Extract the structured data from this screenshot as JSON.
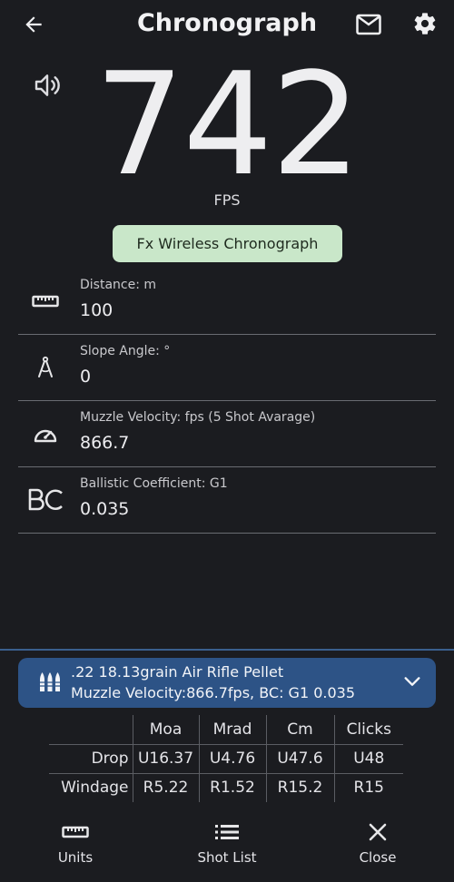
{
  "header": {
    "title": "Chronograph",
    "back_icon": "arrow-left-icon",
    "mail_icon": "mail-icon",
    "settings_icon": "gear-icon"
  },
  "speed": {
    "value": "742",
    "unit": "FPS",
    "sound_icon": "speaker-icon"
  },
  "device": {
    "label": "Fx Wireless Chronograph"
  },
  "fields": [
    {
      "icon": "ruler-icon",
      "label": "Distance: m",
      "value": "100"
    },
    {
      "icon": "compass-angle-icon",
      "label": "Slope Angle: °",
      "value": "0"
    },
    {
      "icon": "speedometer-icon",
      "label": "Muzzle Velocity: fps (5 Shot Avarage)",
      "value": "866.7"
    },
    {
      "icon": "bc-icon",
      "label": "Ballistic Coefficient: G1",
      "value": "0.035"
    }
  ],
  "ammo": {
    "icon": "bullets-icon",
    "name": ".22 18.13grain Air Rifle Pellet",
    "details": "Muzzle Velocity:866.7fps, BC: G1 0.035",
    "expand_icon": "chevron-down-icon"
  },
  "ballistics": {
    "columns": [
      "Moa",
      "Mrad",
      "Cm",
      "Clicks"
    ],
    "rows": [
      {
        "label": "Drop",
        "values": [
          "U16.37",
          "U4.76",
          "U47.6",
          "U48"
        ]
      },
      {
        "label": "Windage",
        "values": [
          "R5.22",
          "R1.52",
          "R15.2",
          "R15"
        ]
      }
    ]
  },
  "nav": [
    {
      "icon": "ruler-icon",
      "label": "Units"
    },
    {
      "icon": "list-icon",
      "label": "Shot List"
    },
    {
      "icon": "close-icon",
      "label": "Close"
    }
  ],
  "colors": {
    "background": "#1b1c20",
    "chip": "#c9e7c9",
    "ammo_card": "#2d5386",
    "divider": "#6a6c72"
  }
}
